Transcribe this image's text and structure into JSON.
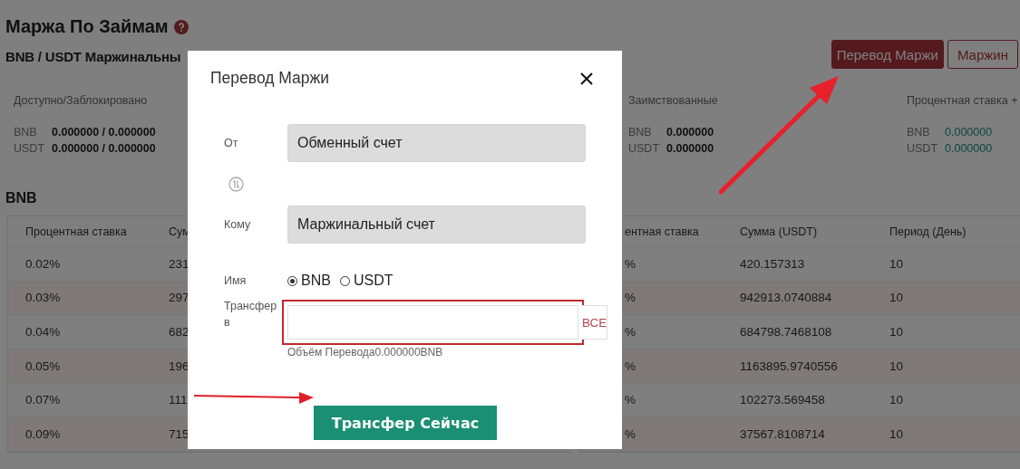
{
  "page": {
    "title": "Маржа По Займам",
    "pair_title": "BNB / USDT Маржинальны",
    "actions": [
      {
        "label": "Перевод Маржи",
        "kind": "primary"
      },
      {
        "label": "Маржин",
        "kind": "outline"
      }
    ]
  },
  "stats": [
    {
      "title": "Доступно/Заблокировано",
      "kind": "plain",
      "rows": [
        {
          "asset": "BNB",
          "value": "0.000000 / 0.000000"
        },
        {
          "asset": "USDT",
          "value": "0.000000 / 0.000000"
        }
      ]
    },
    {
      "title": "Заимствованные",
      "kind": "plain",
      "rows": [
        {
          "asset": "BNB",
          "value": "0.000000"
        },
        {
          "asset": "USDT",
          "value": "0.000000"
        }
      ]
    },
    {
      "title": "Процентная ставка +",
      "kind": "accent",
      "rows": [
        {
          "asset": "BNB",
          "value": "0.000000"
        },
        {
          "asset": "USDT",
          "value": "0.000000"
        }
      ]
    }
  ],
  "section_title": "BNB",
  "tables": [
    {
      "columns": [
        "Процентная ставка",
        "Сум"
      ],
      "rows": [
        [
          "0.02%",
          "231"
        ],
        [
          "0.03%",
          "297"
        ],
        [
          "0.04%",
          "682"
        ],
        [
          "0.05%",
          "196"
        ],
        [
          "0.07%",
          "111"
        ],
        [
          "0.09%",
          "715"
        ]
      ]
    },
    {
      "columns": [
        "ентная ставка",
        "Сумма  (USDT)",
        "Период (День)"
      ],
      "rows": [
        [
          "%",
          "420.157313",
          "10"
        ],
        [
          "%",
          "942913.0740884",
          "10"
        ],
        [
          "%",
          "684798.7468108",
          "10"
        ],
        [
          "%",
          "1163895.9740556",
          "10"
        ],
        [
          "%",
          "102273.569458",
          "10"
        ],
        [
          "%",
          "37567.8108714",
          "10"
        ]
      ]
    }
  ],
  "dialog": {
    "title": "Перевод Маржи",
    "from": {
      "label": "От",
      "value": "Обменный счет"
    },
    "to": {
      "label": "Кому",
      "value": "Маржинальный счет"
    },
    "asset": {
      "label": "Имя",
      "options": [
        {
          "label": "BNB",
          "selected": true
        },
        {
          "label": "USDT",
          "selected": false
        }
      ]
    },
    "amount": {
      "label": "Трансфер в",
      "max_label": "ВСЕ",
      "hint": "Объём Перевода0.000000BNB"
    },
    "submit": "Трансфер Сейчас"
  }
}
